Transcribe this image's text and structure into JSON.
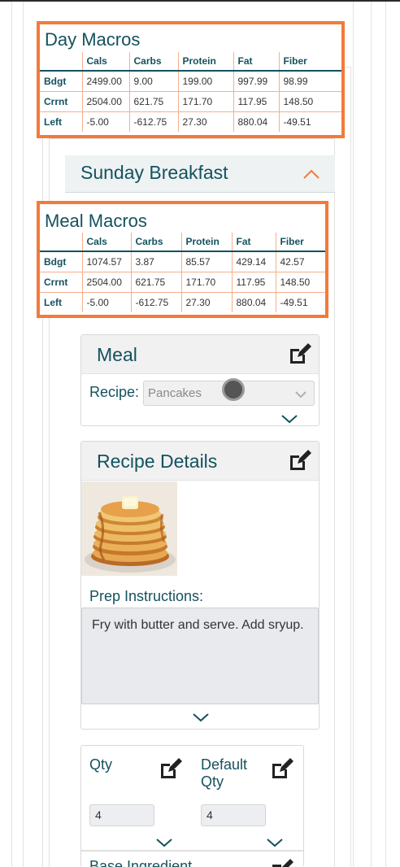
{
  "day_macros": {
    "title": "Day Macros",
    "columns": [
      "",
      "Cals",
      "Carbs",
      "Protein",
      "Fat",
      "Fiber"
    ],
    "rows": [
      {
        "label": "Bdgt",
        "values": [
          "2499.00",
          "9.00",
          "199.00",
          "997.99",
          "98.99"
        ]
      },
      {
        "label": "Crrnt",
        "values": [
          "2504.00",
          "621.75",
          "171.70",
          "117.95",
          "148.50"
        ]
      },
      {
        "label": "Left",
        "values": [
          "-5.00",
          "-612.75",
          "27.30",
          "880.04",
          "-49.51"
        ]
      }
    ]
  },
  "meal_section": {
    "title": "Sunday Breakfast",
    "collapse_icon": "chevron-up-icon"
  },
  "meal_macros": {
    "title": "Meal Macros",
    "columns": [
      "",
      "Cals",
      "Carbs",
      "Protein",
      "Fat",
      "Fiber"
    ],
    "rows": [
      {
        "label": "Bdgt",
        "values": [
          "1074.57",
          "3.87",
          "85.57",
          "429.14",
          "42.57"
        ]
      },
      {
        "label": "Crrnt",
        "values": [
          "2504.00",
          "621.75",
          "171.70",
          "117.95",
          "148.50"
        ]
      },
      {
        "label": "Left",
        "values": [
          "-5.00",
          "-612.75",
          "27.30",
          "880.04",
          "-49.51"
        ]
      }
    ]
  },
  "meal_card": {
    "title": "Meal",
    "recipe_label": "Recipe:",
    "recipe_value": "Pancakes"
  },
  "recipe_details": {
    "title": "Recipe Details",
    "prep_label": "Prep Instructions:",
    "prep_text": "Fry with butter and serve. Add sryup."
  },
  "quantities": {
    "qty_label": "Qty",
    "qty_value": "4",
    "default_qty_label_line1": "Default",
    "default_qty_label_line2": "Qty",
    "default_qty_value": "4"
  },
  "base_ingredient": {
    "title": "Base Ingredient"
  },
  "colors": {
    "accent": "#f37a3a",
    "heading": "#14525e"
  }
}
